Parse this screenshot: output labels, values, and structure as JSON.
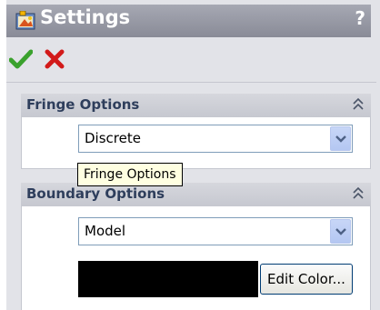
{
  "window": {
    "title": "Settings",
    "help_label": "?"
  },
  "actions": {
    "ok_icon": "check-icon",
    "cancel_icon": "x-icon"
  },
  "fringe_options": {
    "title": "Fringe Options",
    "selected_value": "Discrete",
    "tooltip": "Fringe Options"
  },
  "boundary_options": {
    "title": "Boundary Options",
    "selected_value": "Model",
    "color_value": "#000000",
    "edit_color_label": "Edit Color..."
  },
  "colors": {
    "titlebar": "#898b97",
    "panel": "#e2e3e8",
    "group_title": "#2e3e5c",
    "ok_green": "#3aa12d",
    "cancel_red": "#d21a1a"
  }
}
